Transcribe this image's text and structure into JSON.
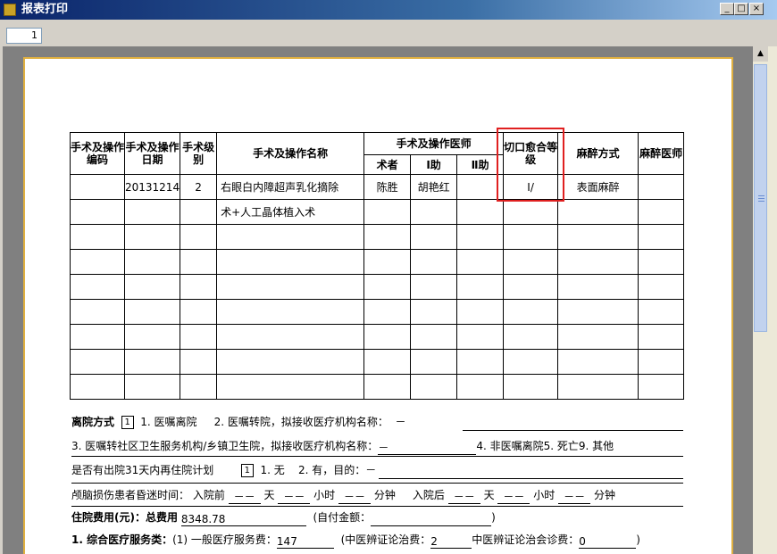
{
  "window": {
    "title": "报表打印",
    "min_label": "_",
    "max_label": "□",
    "close_label": "×"
  },
  "toolbar": {
    "page": "1"
  },
  "table": {
    "header": {
      "code": "手术及操作编码",
      "date": "手术及操作日期",
      "level": "手术级别",
      "name": "手术及操作名称",
      "doctors": "手术及操作医师",
      "surgeon": "术者",
      "asst1": "Ⅰ助",
      "asst2": "Ⅱ助",
      "incision": "切口愈合等级",
      "anesthesia": "麻醉方式",
      "anesthetist": "麻醉医师"
    },
    "row1": {
      "code": "",
      "date": "20131214",
      "level": "2",
      "name": "右眼白内障超声乳化摘除",
      "surgeon": "陈胜",
      "asst1": "胡艳红",
      "asst2": "",
      "incision": "Ⅰ/",
      "anesthesia": "表面麻醉",
      "anesthetist": ""
    },
    "row2": {
      "name": "术+人工晶体植入术"
    }
  },
  "form": {
    "discharge": {
      "label": "离院方式",
      "value": "1",
      "opt1": "1. 医嘱离院",
      "opt2": "2. 医嘱转院，拟接收医疗机构名称：",
      "opt2_val": "－"
    },
    "line3": {
      "text": "3. 医嘱转社区卫生服务机构/乡镇卫生院，拟接收医疗机构名称：",
      "val": "－",
      "rest": "4. 非医嘱离院5. 死亡9. 其他"
    },
    "readmit": {
      "text": "是否有出院31天内再住院计划",
      "value": "1",
      "opt1": "1. 无",
      "opt2": "2. 有，目的：",
      "val": "－"
    },
    "coma": {
      "text": "颅脑损伤患者昏迷时间：  入院前",
      "before_d": "－－",
      "day1": "天",
      "before_h": "－－",
      "hour1": "小时",
      "before_m": "－－",
      "min1": "分钟",
      "after_label": "入院后",
      "after_d": "－－",
      "day2": "天",
      "after_h": "－－",
      "hour2": "小时",
      "after_m": "－－",
      "min2": "分钟"
    },
    "cost": {
      "label": "住院费用(元)：总费用",
      "total": "8348.78",
      "self_label": "(自付金额：",
      "self_val": "",
      "close": ")"
    },
    "service": {
      "label": "1. 综合医疗服务类：",
      "item1": "(1) 一般医疗服务费：",
      "val1": "147",
      "item2": "(中医辨证论治费：",
      "val2": "2",
      "item3": "中医辨证论治会诊费：",
      "val3": "0",
      "close": ")"
    }
  },
  "colors": {
    "highlight": "#e02020",
    "paper_border": "#e0b040"
  }
}
